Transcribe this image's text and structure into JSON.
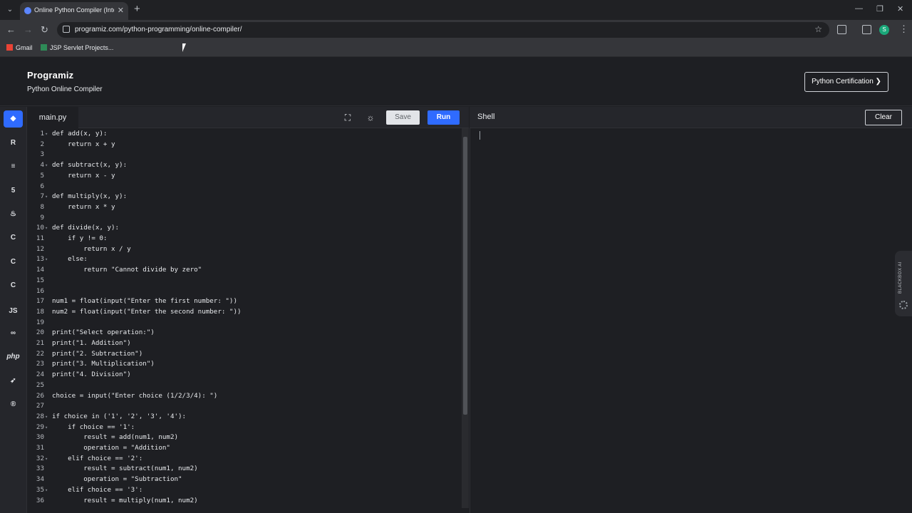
{
  "browser": {
    "tab_title": "Online Python Compiler (Interp",
    "url": "programiz.com/python-programming/online-compiler/",
    "bookmarks": [
      "Gmail",
      "JSP Servlet Projects..."
    ],
    "profile_initial": "S"
  },
  "header": {
    "logo": "Programiz",
    "subtitle": "Python Online Compiler",
    "cert_button": "Python Certification ❯"
  },
  "sidebar": {
    "items": [
      "python",
      "r",
      "sql",
      "html",
      "java",
      "c",
      "cpp",
      "csharp",
      "JS",
      "go",
      "php",
      "swift",
      "rust"
    ]
  },
  "editor": {
    "file_name": "main.py",
    "save_label": "Save",
    "run_label": "Run",
    "lines": [
      "def add(x, y):",
      "    return x + y",
      "",
      "def subtract(x, y):",
      "    return x - y",
      "",
      "def multiply(x, y):",
      "    return x * y",
      "",
      "def divide(x, y):",
      "    if y != 0:",
      "        return x / y",
      "    else:",
      "        return \"Cannot divide by zero\"",
      "",
      "",
      "num1 = float(input(\"Enter the first number: \"))",
      "num2 = float(input(\"Enter the second number: \"))",
      "",
      "print(\"Select operation:\")",
      "print(\"1. Addition\")",
      "print(\"2. Subtraction\")",
      "print(\"3. Multiplication\")",
      "print(\"4. Division\")",
      "",
      "choice = input(\"Enter choice (1/2/3/4): \")",
      "",
      "if choice in ('1', '2', '3', '4'):",
      "    if choice == '1':",
      "        result = add(num1, num2)",
      "        operation = \"Addition\"",
      "    elif choice == '2':",
      "        result = subtract(num1, num2)",
      "        operation = \"Subtraction\"",
      "    elif choice == '3':",
      "        result = multiply(num1, num2)"
    ],
    "fold_lines": [
      1,
      4,
      7,
      10,
      13,
      28,
      29,
      32,
      35
    ]
  },
  "shell": {
    "title": "Shell",
    "clear_label": "Clear"
  },
  "blackbox": {
    "label": "BLACKBOX AI"
  }
}
